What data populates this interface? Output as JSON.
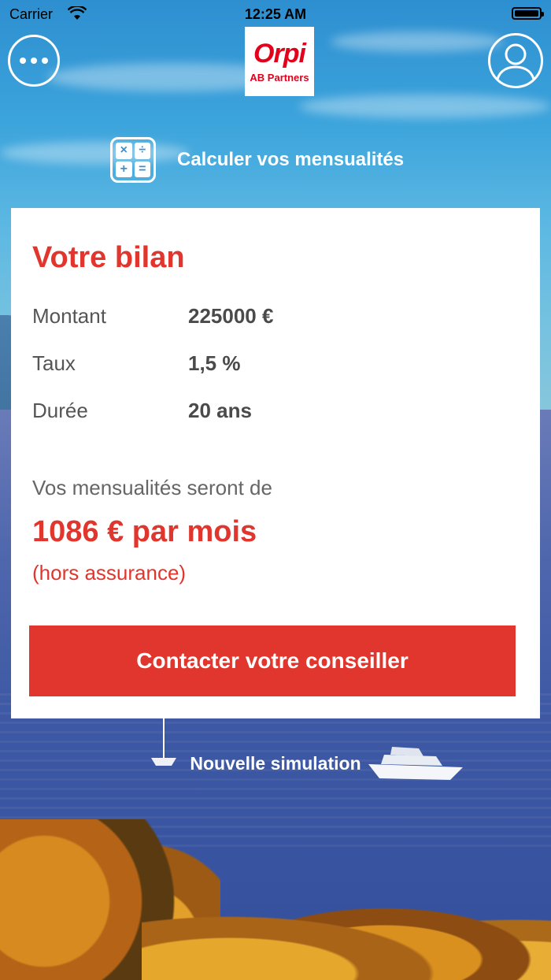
{
  "status_bar": {
    "carrier": "Carrier",
    "time": "12:25 AM"
  },
  "header": {
    "logo_word": "Orpi",
    "logo_sub": "AB Partners"
  },
  "calculator": {
    "title": "Calculer vos mensualités",
    "keys": [
      "×",
      "÷",
      "+",
      "="
    ]
  },
  "card": {
    "title": "Votre bilan",
    "rows": [
      {
        "label": "Montant",
        "value": "225000 €"
      },
      {
        "label": "Taux",
        "value": "1,5 %"
      },
      {
        "label": "Durée",
        "value": "20 ans"
      }
    ],
    "intro": "Vos mensualités seront de",
    "result": "1086 € par mois",
    "note": "(hors assurance)",
    "contact_label": "Contacter votre conseiller"
  },
  "new_simulation_label": "Nouvelle simulation",
  "colors": {
    "accent": "#e1362d",
    "brand_red": "#e3001b"
  }
}
